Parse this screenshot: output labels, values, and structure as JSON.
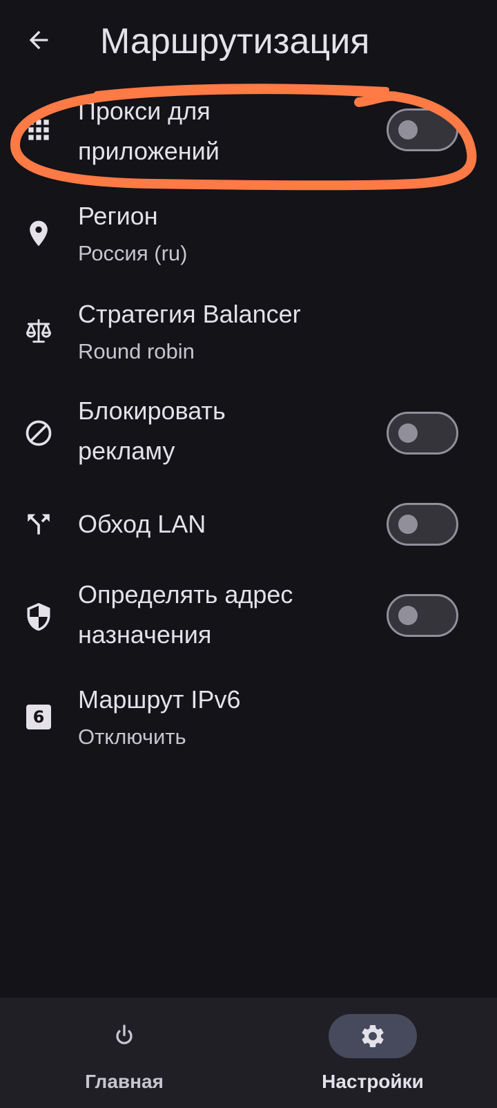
{
  "header": {
    "title": "Маршрутизация",
    "back_icon": "arrow-back-icon"
  },
  "settings": [
    {
      "title": "Прокси для",
      "title2": "приложений",
      "icon": "apps-icon",
      "toggle": false
    },
    {
      "title": "Регион",
      "subtitle": "Россия (ru)",
      "icon": "location-pin-icon"
    },
    {
      "title": "Стратегия Balancer",
      "subtitle": "Round robin",
      "icon": "scale-icon"
    },
    {
      "title": "Блокировать",
      "title2": "рекламу",
      "icon": "block-icon",
      "toggle": false
    },
    {
      "title": "Обход LAN",
      "icon": "fork-icon",
      "toggle": false
    },
    {
      "title": "Определять адрес",
      "title2": "назначения",
      "icon": "shield-icon",
      "toggle": false
    },
    {
      "title": "Маршрут IPv6",
      "subtitle": "Отключить",
      "icon": "number-six-icon",
      "icon_text": "6"
    }
  ],
  "annotation": {
    "color": "#ff7a45"
  },
  "bottom_nav": {
    "items": [
      {
        "label": "Главная",
        "icon": "power-icon",
        "active": false
      },
      {
        "label": "Настройки",
        "icon": "gear-icon",
        "active": true
      }
    ]
  },
  "colors": {
    "background": "#131318",
    "text_primary": "#e4e1e9",
    "text_secondary": "#c6c5d0",
    "toggle_outline": "#918f9a",
    "toggle_track": "#35343a",
    "nav_background": "#1f1f25",
    "nav_active_indicator": "#464a5c"
  }
}
